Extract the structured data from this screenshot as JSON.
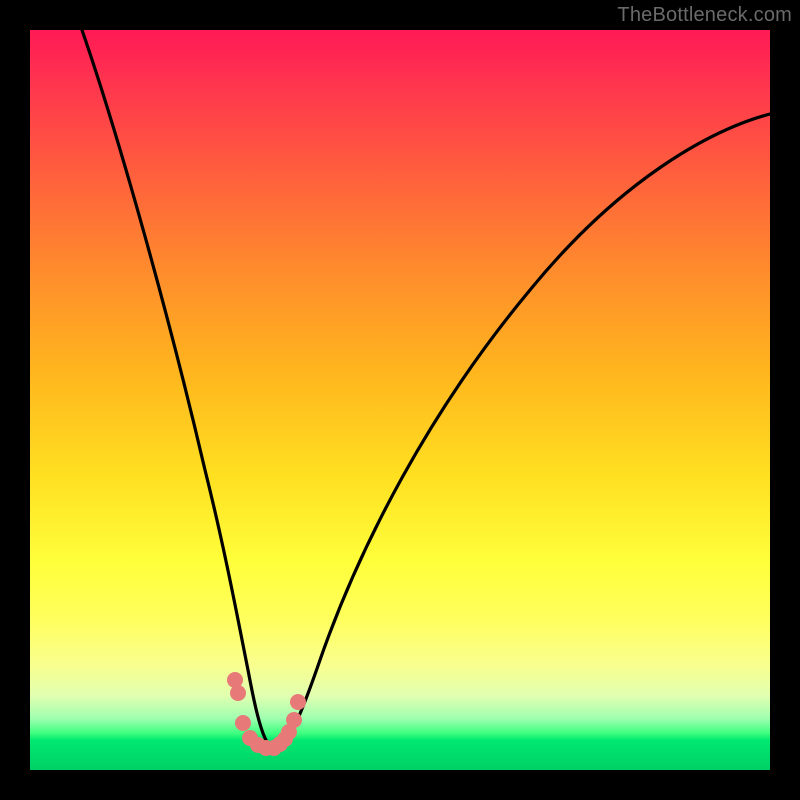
{
  "attribution": "TheBottleneck.com",
  "colors": {
    "background": "#000000",
    "gradient_top": "#ff1a55",
    "gradient_mid": "#ffff3b",
    "gradient_bottom": "#00d065",
    "curve": "#000000",
    "dots": "#e77a78"
  },
  "chart_data": {
    "type": "line",
    "title": "",
    "xlabel": "",
    "ylabel": "",
    "xlim": [
      0,
      100
    ],
    "ylim": [
      0,
      100
    ],
    "series": [
      {
        "name": "curve",
        "x": [
          7,
          10,
          13,
          16,
          19,
          22,
          24.5,
          26.5,
          28,
          29.5,
          31,
          32,
          33,
          35,
          37,
          39,
          42,
          46,
          52,
          60,
          70,
          82,
          100
        ],
        "y": [
          100,
          90,
          79,
          66,
          53,
          38,
          24,
          13,
          7,
          3,
          0.5,
          0,
          0.5,
          2,
          5,
          9,
          16,
          28,
          42,
          56,
          67,
          76,
          85
        ]
      }
    ],
    "scatter": {
      "name": "dots",
      "x": [
        27.2,
        27.6,
        28.3,
        29.2,
        30.2,
        31.4,
        32.4,
        33.2,
        33.8,
        34.4,
        35.0,
        35.6
      ],
      "y": [
        10.5,
        9.0,
        4.5,
        2.2,
        1.0,
        0.5,
        0.5,
        1.2,
        2.0,
        3.0,
        5.0,
        8.2
      ]
    },
    "annotations": []
  }
}
